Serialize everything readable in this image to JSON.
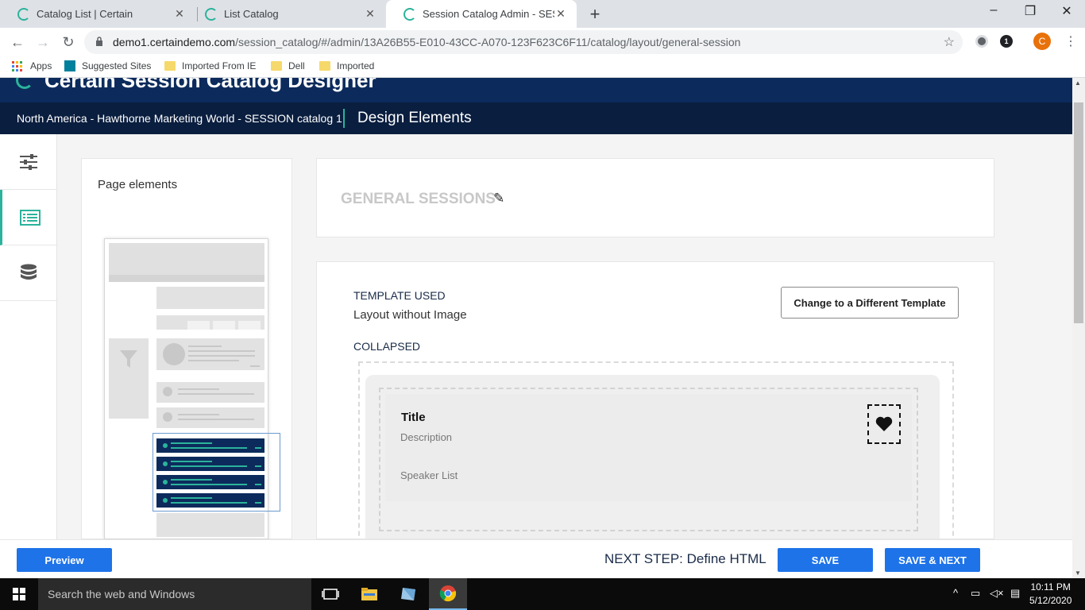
{
  "browser": {
    "tabs": [
      {
        "label": "Catalog List | Certain",
        "close": "✕"
      },
      {
        "label": "List Catalog",
        "close": "✕"
      },
      {
        "label": "Session Catalog Admin - SESSIO",
        "close": "✕"
      }
    ],
    "new_tab": "+",
    "window_controls": {
      "minimize": "–",
      "maximize": "❐",
      "close": "✕"
    },
    "nav": {
      "back": "←",
      "forward": "→",
      "reload": "↻"
    },
    "url_domain": "demo1.certaindemo.com",
    "url_path": "/session_catalog/#/admin/13A26B55-E010-43CC-A070-123F623C6F11/catalog/layout/general-session",
    "bookmark_star": "☆",
    "extension_badge": "1",
    "profile_initial": "C",
    "menu": "⋮",
    "bookmarks": [
      "Apps",
      "Suggested Sites",
      "Imported From IE",
      "Dell",
      "Imported"
    ]
  },
  "app": {
    "title": "Certain  Session Catalog Designer",
    "event_name": "North America - Hawthorne Marketing World - SESSION catalog 1",
    "section_title": "Design Elements"
  },
  "page_elements": {
    "heading": "Page elements"
  },
  "catalog": {
    "name": "GENERAL SESSIONS",
    "edit_icon": "✎"
  },
  "template": {
    "used_label": "TEMPLATE USED",
    "name": "Layout without Image",
    "change_button": "Change to a Different Template",
    "collapsed_label": "COLLAPSED",
    "preview": {
      "title": "Title",
      "description": "Description",
      "speaker_list": "Speaker List"
    }
  },
  "footer": {
    "preview_button": "Preview",
    "next_step": "NEXT STEP: Define HTML",
    "save_button": "SAVE",
    "save_next_button": "SAVE & NEXT"
  },
  "taskbar": {
    "search_placeholder": "Search the web and Windows",
    "time": "10:11 PM",
    "date": "5/12/2020"
  },
  "colors": {
    "brand_navy": "#0c2b5c",
    "accent_teal": "#2bb39b",
    "button_blue": "#1e73e8"
  }
}
